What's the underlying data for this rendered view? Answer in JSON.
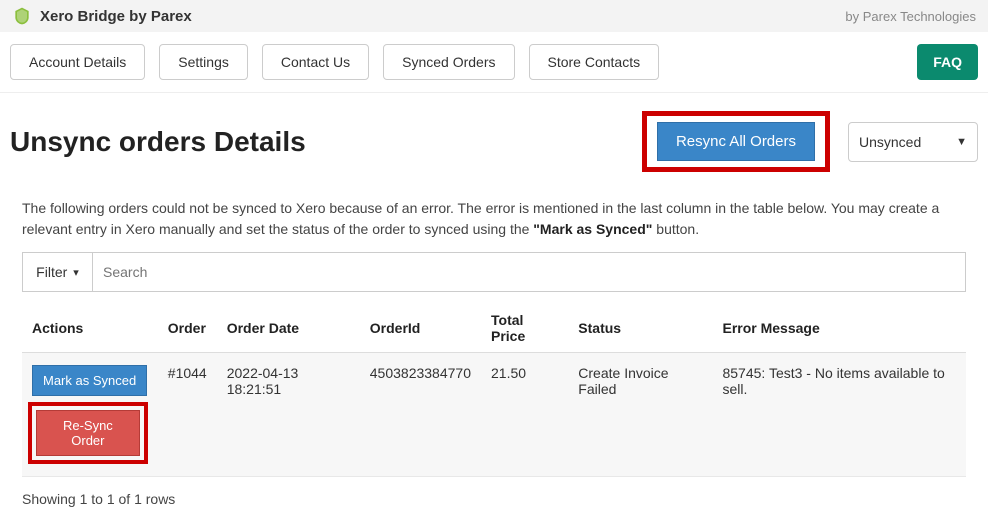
{
  "header": {
    "title": "Xero Bridge by Parex",
    "right": "by Parex Technologies"
  },
  "nav": {
    "items": [
      "Account Details",
      "Settings",
      "Contact Us",
      "Synced Orders",
      "Store Contacts"
    ],
    "faq": "FAQ"
  },
  "page": {
    "title": "Unsync orders Details",
    "resync_all": "Resync All Orders",
    "filter_select": "Unsynced"
  },
  "instruction": {
    "pre": "The following orders could not be synced to Xero because of an error. The error is mentioned in the last column in the table below. You may create a relevant entry in Xero manually and set the status of the order to synced using the ",
    "bold": "\"Mark as Synced\"",
    "post": " button."
  },
  "toolbar": {
    "filter_label": "Filter",
    "search_placeholder": "Search"
  },
  "table": {
    "columns": [
      "Actions",
      "Order",
      "Order Date",
      "OrderId",
      "Total Price",
      "Status",
      "Error Message"
    ],
    "rows": [
      {
        "mark_synced": "Mark as Synced",
        "resync": "Re-Sync Order",
        "order": "#1044",
        "order_date": "2022-04-13 18:21:51",
        "order_id": "4503823384770",
        "total_price": "21.50",
        "status": "Create Invoice Failed",
        "error_message": "85745: Test3 - No items available to sell."
      }
    ]
  },
  "pager": "Showing 1 to 1 of 1 rows"
}
